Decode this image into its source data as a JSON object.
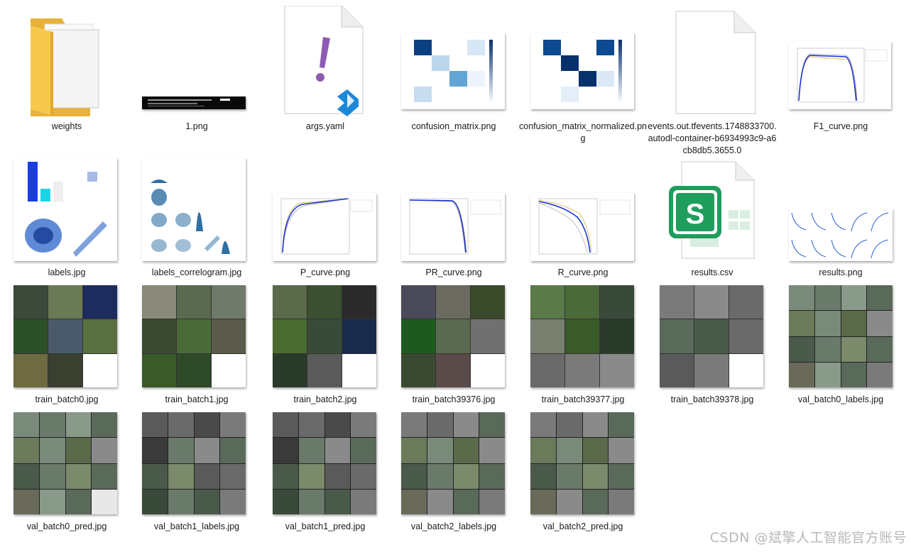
{
  "files": [
    {
      "name": "weights",
      "type": "folder"
    },
    {
      "name": "1.png",
      "type": "image"
    },
    {
      "name": "args.yaml",
      "type": "yaml"
    },
    {
      "name": "confusion_matrix.png",
      "type": "image"
    },
    {
      "name": "confusion_matrix_normalized.png",
      "type": "image"
    },
    {
      "name": "events.out.tfevents.1748833700.autodl-container-b6934993c9-a6cb8db5.3655.0",
      "type": "file"
    },
    {
      "name": "F1_curve.png",
      "type": "image"
    },
    {
      "name": "labels.jpg",
      "type": "image"
    },
    {
      "name": "labels_correlogram.jpg",
      "type": "image"
    },
    {
      "name": "P_curve.png",
      "type": "image"
    },
    {
      "name": "PR_curve.png",
      "type": "image"
    },
    {
      "name": "R_curve.png",
      "type": "image"
    },
    {
      "name": "results.csv",
      "type": "spreadsheet"
    },
    {
      "name": "results.png",
      "type": "image"
    },
    {
      "name": "train_batch0.jpg",
      "type": "image"
    },
    {
      "name": "train_batch1.jpg",
      "type": "image"
    },
    {
      "name": "train_batch2.jpg",
      "type": "image"
    },
    {
      "name": "train_batch39376.jpg",
      "type": "image"
    },
    {
      "name": "train_batch39377.jpg",
      "type": "image"
    },
    {
      "name": "train_batch39378.jpg",
      "type": "image"
    },
    {
      "name": "val_batch0_labels.jpg",
      "type": "image"
    },
    {
      "name": "val_batch0_pred.jpg",
      "type": "image"
    },
    {
      "name": "val_batch1_labels.jpg",
      "type": "image"
    },
    {
      "name": "val_batch1_pred.jpg",
      "type": "image"
    },
    {
      "name": "val_batch2_labels.jpg",
      "type": "image"
    },
    {
      "name": "val_batch2_pred.jpg",
      "type": "image"
    }
  ],
  "watermark": "CSDN @斌擎人工智能官方账号",
  "colors": {
    "folder": "#f6c94e",
    "vscode_blue": "#1e88d8",
    "excel_green": "#1f9d5c",
    "yaml_purple": "#8e5bb3"
  },
  "icons": {
    "folder": "folder-icon",
    "yaml": "yaml-file-icon",
    "file": "generic-file-icon",
    "spreadsheet": "spreadsheet-icon"
  }
}
